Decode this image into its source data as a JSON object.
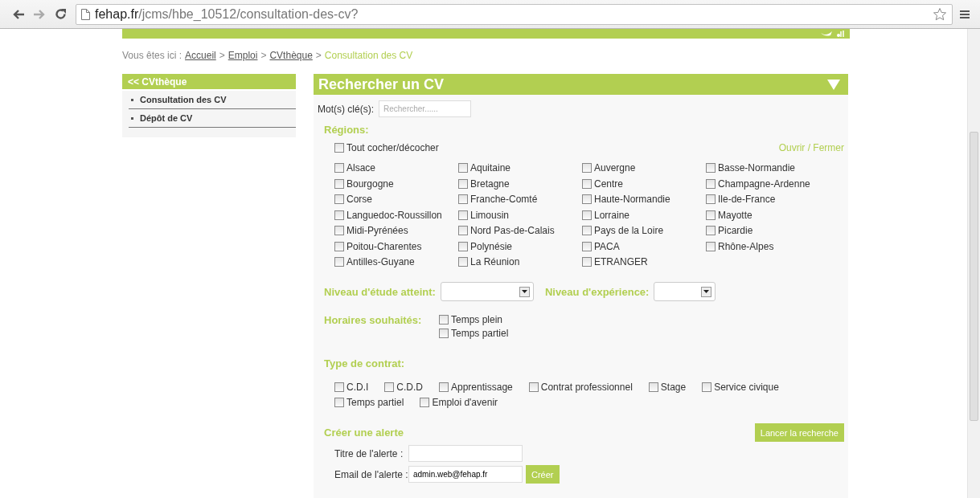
{
  "browser": {
    "url_domain": "fehap.fr",
    "url_path": "/jcms/hbe_10512/consultation-des-cv?"
  },
  "breadcrumb": [
    {
      "kind": "text",
      "text": "Vous êtes ici :"
    },
    {
      "kind": "link",
      "text": "Accueil"
    },
    {
      "kind": "sep",
      "text": ">"
    },
    {
      "kind": "link",
      "text": "Emploi"
    },
    {
      "kind": "sep",
      "text": ">"
    },
    {
      "kind": "link",
      "text": "CVthèque"
    },
    {
      "kind": "sep",
      "text": ">"
    },
    {
      "kind": "current",
      "text": "Consultation des CV"
    }
  ],
  "sidebar": {
    "header": "<< CVthèque",
    "items": [
      {
        "label": "Consultation des CV"
      },
      {
        "label": "Dépôt de CV"
      }
    ]
  },
  "search": {
    "title": "Rechercher un CV",
    "keywords_label": "Mot(s) clé(s):",
    "keywords_placeholder": "Rechercher......",
    "regions_heading": "Régions:",
    "toggle_all": {
      "label": "Tout cocher/décocher",
      "checked": false
    },
    "open_close": "Ouvrir / Fermer",
    "regions": [
      {
        "label": "Alsace",
        "checked": false
      },
      {
        "label": "Aquitaine",
        "checked": false
      },
      {
        "label": "Auvergne",
        "checked": false
      },
      {
        "label": "Basse-Normandie",
        "checked": false
      },
      {
        "label": "Bourgogne",
        "checked": false
      },
      {
        "label": "Bretagne",
        "checked": false
      },
      {
        "label": "Centre",
        "checked": false
      },
      {
        "label": "Champagne-Ardenne",
        "checked": false
      },
      {
        "label": "Corse",
        "checked": false
      },
      {
        "label": "Franche-Comté",
        "checked": false
      },
      {
        "label": "Haute-Normandie",
        "checked": false
      },
      {
        "label": "Ile-de-France",
        "checked": false
      },
      {
        "label": "Languedoc-Roussillon",
        "checked": false
      },
      {
        "label": "Limousin",
        "checked": false
      },
      {
        "label": "Lorraine",
        "checked": false
      },
      {
        "label": "Mayotte",
        "checked": false
      },
      {
        "label": "Midi-Pyrénées",
        "checked": false
      },
      {
        "label": "Nord Pas-de-Calais",
        "checked": false
      },
      {
        "label": "Pays de la Loire",
        "checked": false
      },
      {
        "label": "Picardie",
        "checked": false
      },
      {
        "label": "Poitou-Charentes",
        "checked": false
      },
      {
        "label": "Polynésie",
        "checked": false
      },
      {
        "label": "PACA",
        "checked": false
      },
      {
        "label": "Rhône-Alpes",
        "checked": false
      },
      {
        "label": "Antilles-Guyane",
        "checked": false
      },
      {
        "label": "La Réunion",
        "checked": false
      },
      {
        "label": "ETRANGER",
        "checked": false
      }
    ],
    "study_level_label": "Niveau d'étude atteint:",
    "experience_label": "Niveau d'expérience:",
    "hours_label": "Horaires souhaités:",
    "hours": [
      {
        "label": "Temps plein",
        "checked": false
      },
      {
        "label": "Temps partiel",
        "checked": false
      }
    ],
    "contract_heading": "Type de contrat:",
    "contracts": [
      {
        "label": "C.D.I",
        "checked": false
      },
      {
        "label": "C.D.D",
        "checked": false
      },
      {
        "label": "Apprentissage",
        "checked": false
      },
      {
        "label": "Contrat professionnel",
        "checked": false
      },
      {
        "label": "Stage",
        "checked": false
      },
      {
        "label": "Service civique",
        "checked": false
      },
      {
        "label": "Temps partiel",
        "checked": false
      },
      {
        "label": "Emploi d'avenir",
        "checked": false
      }
    ],
    "search_button": "Lancer la recherche",
    "alert": {
      "heading": "Créer une alerte",
      "title_label": "Titre de l'alerte :",
      "email_label": "Email de l'alerte :",
      "email_value": "admin.web@fehap.fr",
      "create_button": "Créer"
    }
  }
}
